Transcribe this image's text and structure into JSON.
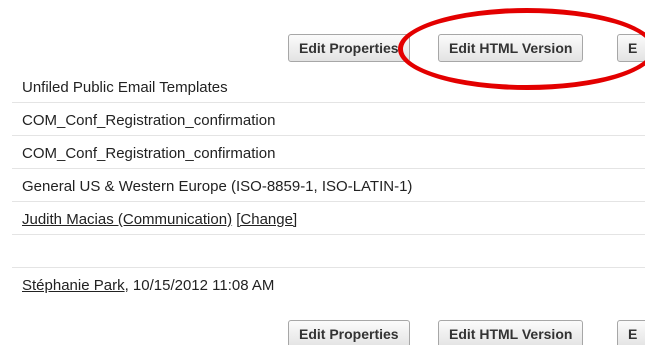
{
  "top_toolbar": {
    "edit_properties_label": "Edit Properties",
    "edit_html_version_label": "Edit HTML Version",
    "truncated_button_label": "E"
  },
  "details": {
    "folder": "Unfiled Public Email Templates",
    "template_name": "COM_Conf_Registration_confirmation",
    "template_unique_name": "COM_Conf_Registration_confirmation",
    "encoding": "General US & Western Europe (ISO-8859-1, ISO-LATIN-1)",
    "author_name": "Judith Macias (Communication)",
    "author_change_link": "[Change]",
    "modified_by_name": "Stéphanie Park",
    "modified_date": ", 10/15/2012 11:08 AM"
  },
  "bottom_toolbar": {
    "edit_properties_label": "Edit Properties",
    "edit_html_version_label": "Edit HTML Version",
    "truncated_button_label": "E"
  },
  "colors": {
    "highlight": "#e30000",
    "row_divider": "#e4e4e4"
  }
}
